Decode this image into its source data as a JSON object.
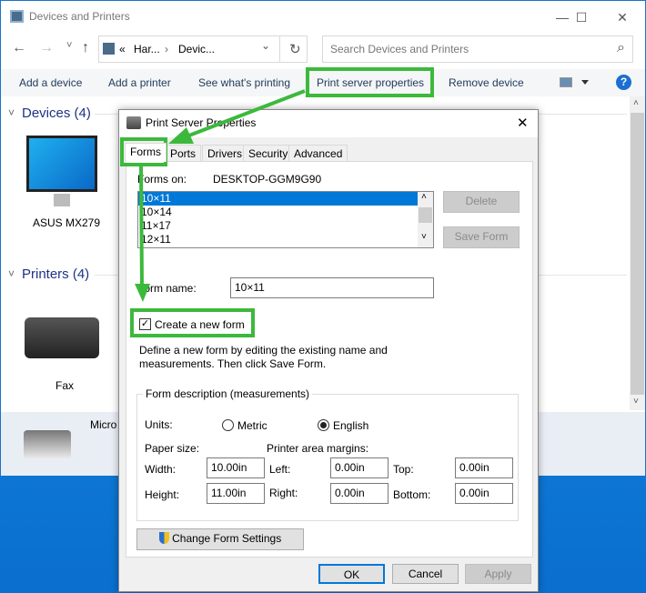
{
  "window": {
    "title": "Devices and Printers",
    "min": "—",
    "max": "☐",
    "close": "✕"
  },
  "nav": {
    "back": "←",
    "forward": "→",
    "recent": "˅",
    "up": "↑",
    "breadcrumb_prefix": "«",
    "crumb1": "Har...",
    "sep": "›",
    "crumb2": "Devic...",
    "dropdown": "⌄",
    "refresh": "↻"
  },
  "search": {
    "placeholder": "Search Devices and Printers",
    "icon": "⌕"
  },
  "commands": [
    "Add a device",
    "Add a printer",
    "See what's printing",
    "Print server properties",
    "Remove device"
  ],
  "help": "?",
  "groups": {
    "devices": "Devices (4)",
    "printers": "Printers (4)"
  },
  "items": {
    "monitor": "ASUS MX279",
    "fax": "Fax",
    "selected": "Micro"
  },
  "dialog": {
    "title": "Print Server Properties",
    "close": "✕",
    "tabs": [
      "Forms",
      "Ports",
      "Drivers",
      "Security",
      "Advanced"
    ],
    "forms_on_label": "Forms on:",
    "forms_on_value": "DESKTOP-GGM9G90",
    "forms": [
      "10×11",
      "10×14",
      "11×17",
      "12×11"
    ],
    "delete": "Delete",
    "save_form": "Save Form",
    "form_name_label": "Form name:",
    "form_name_value": "10×11",
    "create_new": "Create a new form",
    "create_new_checked": true,
    "help_line1": "Define a new form by editing the existing name and",
    "help_line2": "measurements. Then click Save Form.",
    "fieldset": "Form description (measurements)",
    "units_label": "Units:",
    "metric": "Metric",
    "english": "English",
    "units_selected": "English",
    "paper_size": "Paper size:",
    "margins": "Printer area margins:",
    "width_label": "Width:",
    "width": "10.00in",
    "height_label": "Height:",
    "height": "11.00in",
    "left_label": "Left:",
    "left": "0.00in",
    "right_label": "Right:",
    "right": "0.00in",
    "top_label": "Top:",
    "top": "0.00in",
    "bottom_label": "Bottom:",
    "bottom": "0.00in",
    "change_settings": "Change Form Settings",
    "ok": "OK",
    "cancel": "Cancel",
    "apply": "Apply"
  },
  "annotation_color": "#3cb93c"
}
